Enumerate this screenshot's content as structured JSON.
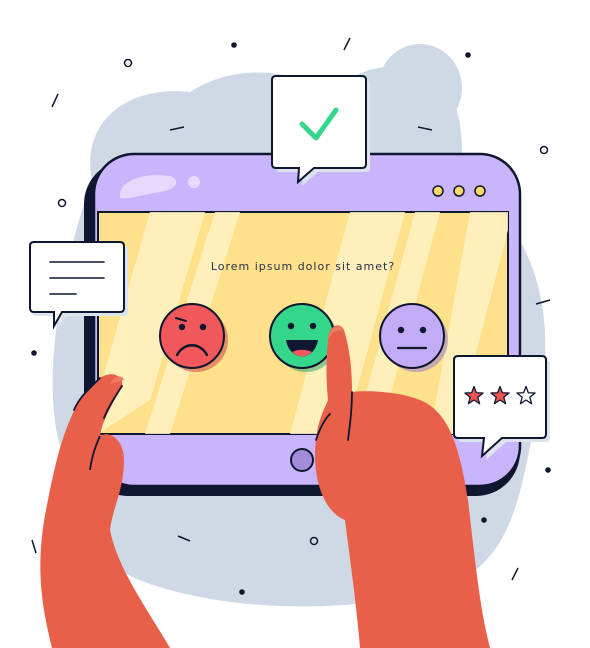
{
  "screen": {
    "question": "Lorem ipsum dolor sit amet?"
  },
  "rating": {
    "value": 2,
    "max": 3
  },
  "colors": {
    "tablet": "#c9b5fb",
    "screen": "#ffe08b",
    "outline": "#0f1730",
    "blob": "#cfd9e5",
    "hand": "#e8604a",
    "sad_face": "#f0585c",
    "happy_face": "#34d68b",
    "neutral_face": "#c2acf5",
    "star_filled": "#f05451",
    "check": "#33d68b"
  },
  "icons": [
    "check-icon",
    "sad-face-icon",
    "happy-face-icon",
    "neutral-face-icon",
    "star-icon",
    "text-lines-icon"
  ]
}
